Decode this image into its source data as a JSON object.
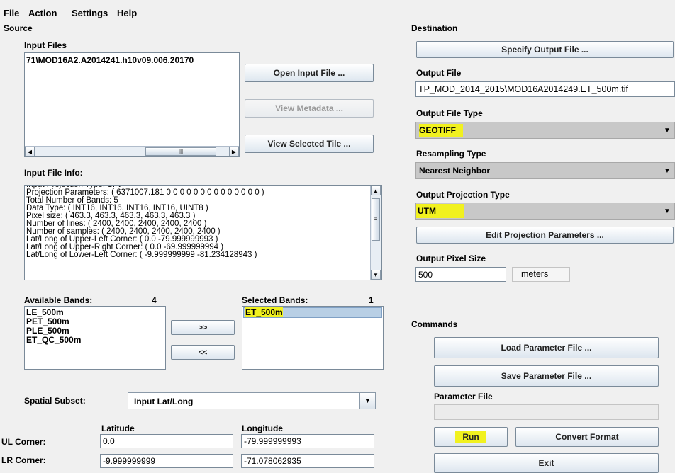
{
  "menu": {
    "file": "File",
    "action": "Action",
    "settings": "Settings",
    "help": "Help"
  },
  "source": {
    "title": "Source",
    "input_files_label": "Input Files",
    "input_file_value": "71\\MOD16A2.A2014241.h10v09.006.20170",
    "open_input_btn": "Open Input File ...",
    "view_metadata_btn": "View Metadata ...",
    "view_selected_tile_btn": "View Selected Tile  ...",
    "input_file_info_label": "Input File Info:",
    "info_lines": [
      "Input Projection Type: SIN",
      "Projection Parameters: ( 6371007.181 0 0 0 0 0 0 0 0 0 0 0 0 0 0 )",
      "Total Number of Bands: 5",
      "Data Type: ( INT16, INT16, INT16, INT16, UINT8 )",
      "Pixel size: ( 463.3, 463.3, 463.3, 463.3, 463.3 )",
      "Number of lines: ( 2400, 2400, 2400, 2400, 2400 )",
      "Number of samples: ( 2400, 2400, 2400, 2400, 2400 )",
      "Lat/Long of Upper-Left Corner: ( 0.0 -79.999999993 )",
      "Lat/Long of Upper-Right Corner: ( 0.0 -69.999999994 )",
      "Lat/Long of Lower-Left Corner: ( -9.999999999 -81.234128943 )"
    ],
    "available_bands_label": "Available Bands:",
    "available_bands_count": "4",
    "available_bands": [
      "LE_500m",
      "PET_500m",
      "PLE_500m",
      "ET_QC_500m"
    ],
    "add_btn": ">>",
    "remove_btn": "<<",
    "selected_bands_label": "Selected Bands:",
    "selected_bands_count": "1",
    "selected_bands": [
      "ET_500m"
    ],
    "spatial_subset_label": "Spatial Subset:",
    "spatial_subset_value": "Input Lat/Long",
    "latitude_label": "Latitude",
    "longitude_label": "Longitude",
    "ul_corner_label": "UL Corner:",
    "ul_lat": "0.0",
    "ul_lon": "-79.999999993",
    "lr_corner_label": "LR Corner:",
    "lr_lat": "-9.999999999",
    "lr_lon": "-71.078062935"
  },
  "destination": {
    "title": "Destination",
    "specify_output_btn": "Specify Output File ...",
    "output_file_label": "Output File",
    "output_file_value": "TP_MOD_2014_2015\\MOD16A2014249.ET_500m.tif",
    "output_file_type_label": "Output File Type",
    "output_file_type_value": "GEOTIFF",
    "resampling_type_label": "Resampling Type",
    "resampling_type_value": "Nearest Neighbor",
    "output_projection_type_label": "Output Projection Type",
    "output_projection_type_value": "UTM",
    "edit_projection_btn": "Edit Projection Parameters ...",
    "output_pixel_size_label": "Output Pixel Size",
    "output_pixel_size_value": "500",
    "pixel_unit": "meters"
  },
  "commands": {
    "title": "Commands",
    "load_param_btn": "Load Parameter File ...",
    "save_param_btn": "Save Parameter File ...",
    "parameter_file_label": "Parameter File",
    "parameter_file_value": "",
    "run_btn": "Run",
    "convert_format_btn": "Convert Format",
    "exit_btn": "Exit"
  }
}
